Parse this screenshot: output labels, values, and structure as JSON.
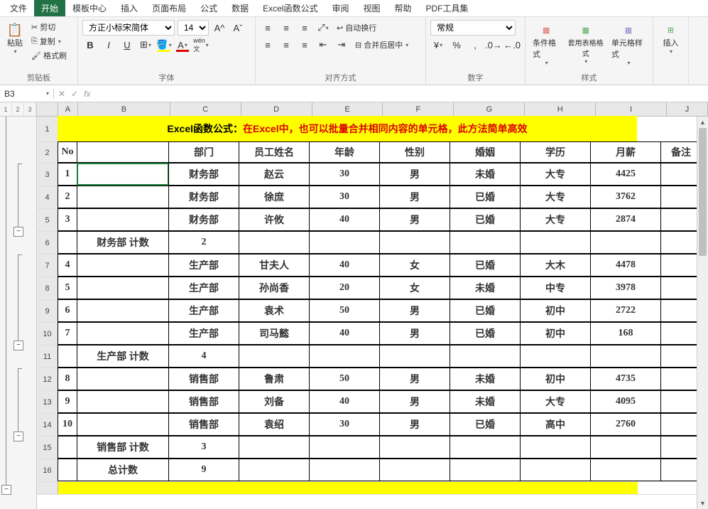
{
  "menu": {
    "items": [
      "文件",
      "开始",
      "模板中心",
      "插入",
      "页面布局",
      "公式",
      "数据",
      "Excel函数公式",
      "审阅",
      "视图",
      "帮助",
      "PDF工具集"
    ],
    "active_index": 1
  },
  "ribbon": {
    "clipboard": {
      "paste": "粘贴",
      "cut": "剪切",
      "copy": "复制",
      "format_painter": "格式刷",
      "label": "剪贴板"
    },
    "font": {
      "name": "方正小标宋简体",
      "size": "14",
      "label": "字体"
    },
    "align": {
      "wrap": "自动换行",
      "merge": "合并后居中",
      "label": "对齐方式"
    },
    "number": {
      "format": "常规",
      "label": "数字"
    },
    "styles": {
      "cond": "条件格式",
      "table": "套用表格格式",
      "cell": "单元格样式",
      "label": "样式"
    },
    "insert": "插入"
  },
  "namebox": "B3",
  "columns": [
    "A",
    "B",
    "C",
    "D",
    "E",
    "F",
    "G",
    "H",
    "I",
    "J"
  ],
  "title": {
    "prefix": "Excel函数公式：",
    "red": "在Excel中，也可以批量合并相同内容的单元格，此方法简单高效"
  },
  "headers": {
    "no": "No",
    "b": "",
    "dept": "部门",
    "name": "员工姓名",
    "age": "年龄",
    "gender": "性别",
    "marriage": "婚姻",
    "edu": "学历",
    "salary": "月薪",
    "note": "备注"
  },
  "rows": [
    {
      "rn": 3,
      "no": "1",
      "b": "",
      "dept": "财务部",
      "name": "赵云",
      "age": "30",
      "gender": "男",
      "mar": "未婚",
      "edu": "大专",
      "sal": "4425",
      "note": ""
    },
    {
      "rn": 4,
      "no": "2",
      "b": "",
      "dept": "财务部",
      "name": "徐庶",
      "age": "30",
      "gender": "男",
      "mar": "已婚",
      "edu": "大专",
      "sal": "3762",
      "note": ""
    },
    {
      "rn": 5,
      "no": "3",
      "b": "",
      "dept": "财务部",
      "name": "许攸",
      "age": "40",
      "gender": "男",
      "mar": "已婚",
      "edu": "大专",
      "sal": "2874",
      "note": ""
    },
    {
      "rn": 6,
      "no": "",
      "b": "财务部 计数",
      "dept": "2",
      "name": "",
      "age": "",
      "gender": "",
      "mar": "",
      "edu": "",
      "sal": "",
      "note": ""
    },
    {
      "rn": 7,
      "no": "4",
      "b": "",
      "dept": "生产部",
      "name": "甘夫人",
      "age": "40",
      "gender": "女",
      "mar": "已婚",
      "edu": "大木",
      "sal": "4478",
      "note": ""
    },
    {
      "rn": 8,
      "no": "5",
      "b": "",
      "dept": "生产部",
      "name": "孙尚香",
      "age": "20",
      "gender": "女",
      "mar": "未婚",
      "edu": "中专",
      "sal": "3978",
      "note": ""
    },
    {
      "rn": 9,
      "no": "6",
      "b": "",
      "dept": "生产部",
      "name": "袁术",
      "age": "50",
      "gender": "男",
      "mar": "已婚",
      "edu": "初中",
      "sal": "2722",
      "note": ""
    },
    {
      "rn": 10,
      "no": "7",
      "b": "",
      "dept": "生产部",
      "name": "司马懿",
      "age": "40",
      "gender": "男",
      "mar": "已婚",
      "edu": "初中",
      "sal": "168",
      "note": ""
    },
    {
      "rn": 11,
      "no": "",
      "b": "生产部 计数",
      "dept": "4",
      "name": "",
      "age": "",
      "gender": "",
      "mar": "",
      "edu": "",
      "sal": "",
      "note": ""
    },
    {
      "rn": 12,
      "no": "8",
      "b": "",
      "dept": "销售部",
      "name": "鲁肃",
      "age": "50",
      "gender": "男",
      "mar": "未婚",
      "edu": "初中",
      "sal": "4735",
      "note": ""
    },
    {
      "rn": 13,
      "no": "9",
      "b": "",
      "dept": "销售部",
      "name": "刘备",
      "age": "40",
      "gender": "男",
      "mar": "未婚",
      "edu": "大专",
      "sal": "4095",
      "note": ""
    },
    {
      "rn": 14,
      "no": "10",
      "b": "",
      "dept": "销售部",
      "name": "袁绍",
      "age": "30",
      "gender": "男",
      "mar": "已婚",
      "edu": "高中",
      "sal": "2760",
      "note": ""
    },
    {
      "rn": 15,
      "no": "",
      "b": "销售部 计数",
      "dept": "3",
      "name": "",
      "age": "",
      "gender": "",
      "mar": "",
      "edu": "",
      "sal": "",
      "note": ""
    },
    {
      "rn": 16,
      "no": "",
      "b": "总计数",
      "dept": "9",
      "name": "",
      "age": "",
      "gender": "",
      "mar": "",
      "edu": "",
      "sal": "",
      "note": ""
    }
  ],
  "row_heights": {
    "title": 36,
    "header": 30,
    "data": 32
  },
  "outline": {
    "levels": [
      "1",
      "2",
      "3"
    ]
  }
}
